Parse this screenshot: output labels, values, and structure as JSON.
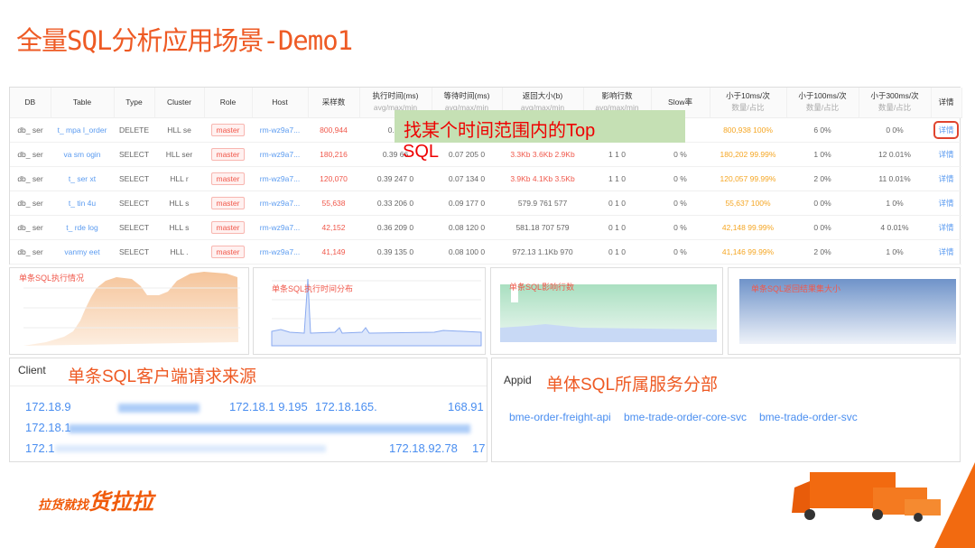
{
  "title": "全量SQL分析应用场景-Demo1",
  "table": {
    "headers": [
      {
        "label": "DB",
        "sub": ""
      },
      {
        "label": "Table",
        "sub": ""
      },
      {
        "label": "Type",
        "sub": ""
      },
      {
        "label": "Cluster",
        "sub": ""
      },
      {
        "label": "Role",
        "sub": ""
      },
      {
        "label": "Host",
        "sub": ""
      },
      {
        "label": "采样数",
        "sub": ""
      },
      {
        "label": "执行时间(ms)",
        "sub": "avg/max/min"
      },
      {
        "label": "等待时间(ms)",
        "sub": "avg/max/min"
      },
      {
        "label": "返回大小(b)",
        "sub": "avg/max/min"
      },
      {
        "label": "影响行数",
        "sub": "avg/max/min"
      },
      {
        "label": "Slow率",
        "sub": ""
      },
      {
        "label": "小于10ms/次",
        "sub": "数量/占比"
      },
      {
        "label": "小于100ms/次",
        "sub": "数量/占比"
      },
      {
        "label": "小于300ms/次",
        "sub": "数量/占比"
      },
      {
        "label": "详情",
        "sub": ""
      }
    ],
    "rows": [
      {
        "db": "db_ ser",
        "table": "t_ mpa l_order",
        "type": "DELETE",
        "cluster": "HLL se",
        "role": "master",
        "host": "rm-wz9a7...",
        "samples": "800,944",
        "exec": "0.38",
        "wait": "",
        "ret": "",
        "rows": "",
        "slow": "%",
        "lt10": "800,938 100%",
        "lt100": "6 0%",
        "lt300": "0 0%",
        "detail": "详情"
      },
      {
        "db": "db_ ser",
        "table": "va sm ogin",
        "type": "SELECT",
        "cluster": "HLL ser",
        "role": "master",
        "host": "rm-wz9a7...",
        "samples": "180,216",
        "exec": "0.39 66",
        "wait": "0.07 205 0",
        "ret": "3.3Kb 3.6Kb 2.9Kb",
        "rows": "1 1 0",
        "slow": "0 %",
        "lt10": "180,202 99.99%",
        "lt100": "1 0%",
        "lt300": "12 0.01%",
        "detail": "详情"
      },
      {
        "db": "db_ ser",
        "table": "t_ ser xt",
        "type": "SELECT",
        "cluster": "HLL r",
        "role": "master",
        "host": "rm-wz9a7...",
        "samples": "120,070",
        "exec": "0.39 247 0",
        "wait": "0.07 134 0",
        "ret": "3.9Kb 4.1Kb 3.5Kb",
        "rows": "1 1 0",
        "slow": "0 %",
        "lt10": "120,057 99.99%",
        "lt100": "2 0%",
        "lt300": "11 0.01%",
        "detail": "详情"
      },
      {
        "db": "db_ ser",
        "table": "t_ tin 4u",
        "type": "SELECT",
        "cluster": "HLL s",
        "role": "master",
        "host": "rm-wz9a7...",
        "samples": "55,638",
        "exec": "0.33 206 0",
        "wait": "0.09 177 0",
        "ret": "579.9 761 577",
        "rows": "0 1 0",
        "slow": "0 %",
        "lt10": "55,637 100%",
        "lt100": "0 0%",
        "lt300": "1 0%",
        "detail": "详情"
      },
      {
        "db": "db_ ser",
        "table": "t_ rde log",
        "type": "SELECT",
        "cluster": "HLL s",
        "role": "master",
        "host": "rm-wz9a7...",
        "samples": "42,152",
        "exec": "0.36 209 0",
        "wait": "0.08 120 0",
        "ret": "581.18 707 579",
        "rows": "0 1 0",
        "slow": "0 %",
        "lt10": "42,148 99.99%",
        "lt100": "0 0%",
        "lt300": "4 0.01%",
        "detail": "详情"
      },
      {
        "db": "db_ ser",
        "table": "vanmy eet",
        "type": "SELECT",
        "cluster": "HLL .",
        "role": "master",
        "host": "rm-wz9a7...",
        "samples": "41,149",
        "exec": "0.39 135 0",
        "wait": "0.08 100 0",
        "ret": "972.13 1.1Kb 970",
        "rows": "0 1 0",
        "slow": "0 %",
        "lt10": "41,146 99.99%",
        "lt100": "2 0%",
        "lt300": "1 0%",
        "detail": "详情"
      }
    ]
  },
  "overlay": {
    "line1": "找某个时间范围内的Top",
    "line2": "SQL"
  },
  "charts": {
    "exec_count": "单条SQL执行情况",
    "exec_time": "单条SQL执行时间分布",
    "affected": "单条SQL影响行数",
    "result_size": "单条SQL返回结果集大小"
  },
  "client": {
    "header": "Client",
    "title": "单条SQL客户端请求来源",
    "ips": [
      "172.18.9",
      "172.18.1 9.195",
      "172.18.165.",
      "168.91",
      "172.18.1",
      "172.1",
      "172.18.92.78",
      "17"
    ]
  },
  "appid": {
    "header": "Appid",
    "title": "单体SQL所属服务分部",
    "items": [
      "bme-order-freight-api",
      "bme-trade-order-core-svc",
      "bme-trade-order-svc"
    ]
  },
  "logo": {
    "small": "拉货就找",
    "big": "货拉拉"
  },
  "colors": {
    "accent": "#ee5a24",
    "link": "#5b9bf0",
    "danger": "#f0584b",
    "warn": "#f5a623"
  }
}
